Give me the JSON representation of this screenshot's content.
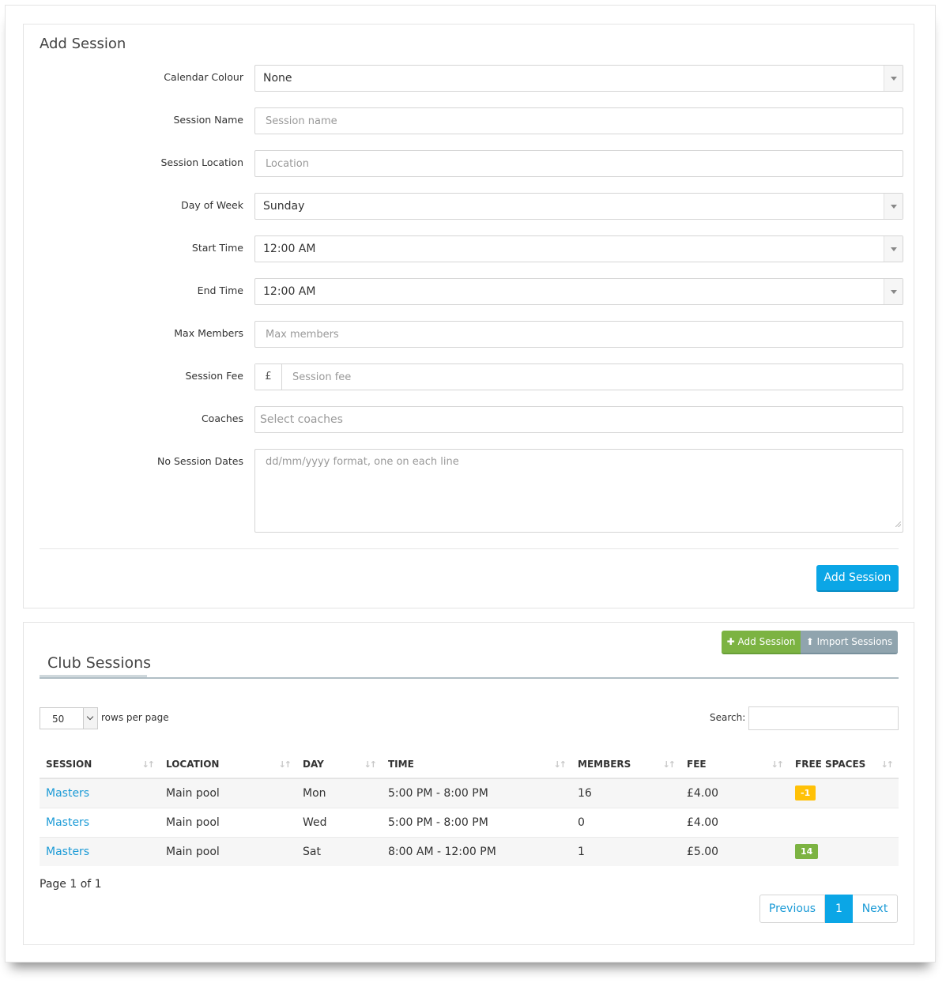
{
  "add_session": {
    "title": "Add Session",
    "fields": {
      "calendar_colour": {
        "label": "Calendar Colour",
        "value": "None"
      },
      "session_name": {
        "label": "Session Name",
        "placeholder": "Session name"
      },
      "session_location": {
        "label": "Session Location",
        "placeholder": "Location"
      },
      "day_of_week": {
        "label": "Day of Week",
        "value": "Sunday"
      },
      "start_time": {
        "label": "Start Time",
        "value": "12:00 AM"
      },
      "end_time": {
        "label": "End Time",
        "value": "12:00 AM"
      },
      "max_members": {
        "label": "Max Members",
        "placeholder": "Max members"
      },
      "session_fee": {
        "label": "Session Fee",
        "addon": "£",
        "placeholder": "Session fee"
      },
      "coaches": {
        "label": "Coaches",
        "placeholder": "Select coaches"
      },
      "no_session_dates": {
        "label": "No Session Dates",
        "placeholder": "dd/mm/yyyy format, one on each line"
      }
    },
    "submit_label": "Add Session",
    "submit_color": "#0ba6e6"
  },
  "club_sessions": {
    "title": "Club Sessions",
    "toolbar": {
      "add_label": "Add Session",
      "add_icon": "plus-icon",
      "import_label": "Import Sessions",
      "import_icon": "upload-icon"
    },
    "length": {
      "value": "50",
      "label": "rows per page"
    },
    "search_label": "Search:",
    "columns": [
      "SESSION",
      "LOCATION",
      "DAY",
      "TIME",
      "MEMBERS",
      "FEE",
      "FREE SPACES"
    ],
    "rows": [
      {
        "session": "Masters",
        "location": "Main pool",
        "day": "Mon",
        "time": "5:00 PM - 8:00 PM",
        "members": "16",
        "fee": "£4.00",
        "free": "-1",
        "free_status": "warning"
      },
      {
        "session": "Masters",
        "location": "Main pool",
        "day": "Wed",
        "time": "5:00 PM - 8:00 PM",
        "members": "0",
        "fee": "£4.00",
        "free": "",
        "free_status": ""
      },
      {
        "session": "Masters",
        "location": "Main pool",
        "day": "Sat",
        "time": "8:00 AM - 12:00 PM",
        "members": "1",
        "fee": "£5.00",
        "free": "14",
        "free_status": "success"
      }
    ],
    "page_info": "Page 1 of 1",
    "pagination": {
      "previous": "Previous",
      "current": "1",
      "next": "Next"
    },
    "colors": {
      "link": "#1a9ad6",
      "warning": "#ffc107",
      "success": "#7cb342"
    }
  }
}
